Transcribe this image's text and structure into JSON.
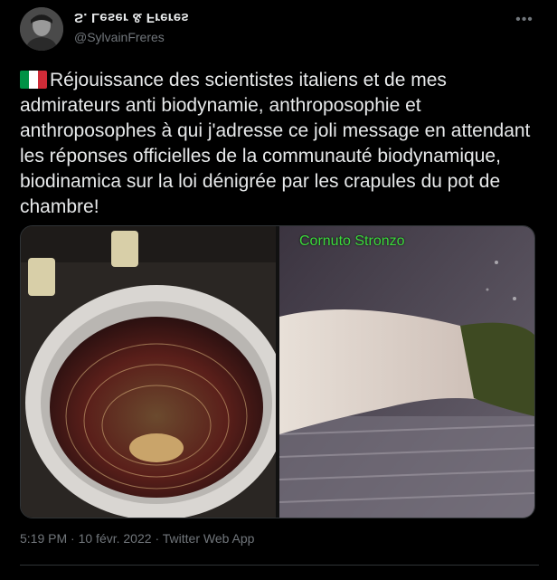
{
  "user": {
    "display_name": "S. Leser & Freres",
    "handle": "@SylvainFreres"
  },
  "tweet": {
    "flag_icon": "italy-flag-icon",
    "text": "Réjouissance des scientistes italiens et de mes admirateurs anti biodynamie, anthroposophie et anthroposophes à qui j'adresse ce joli message en attendant les réponses officielles de la communauté biodynamique, biodinamica sur la loi dénigrée par les crapules du pot de chambre!",
    "image_caption": "Cornuto Stronzo"
  },
  "meta": {
    "time": "5:19 PM",
    "separator": "·",
    "date": "10 févr. 2022",
    "app": "Twitter Web App"
  },
  "colors": {
    "background": "#000000",
    "text": "#e7e9ea",
    "secondary": "#71767b",
    "border": "#2f3336",
    "caption_green": "#3bd93b"
  }
}
